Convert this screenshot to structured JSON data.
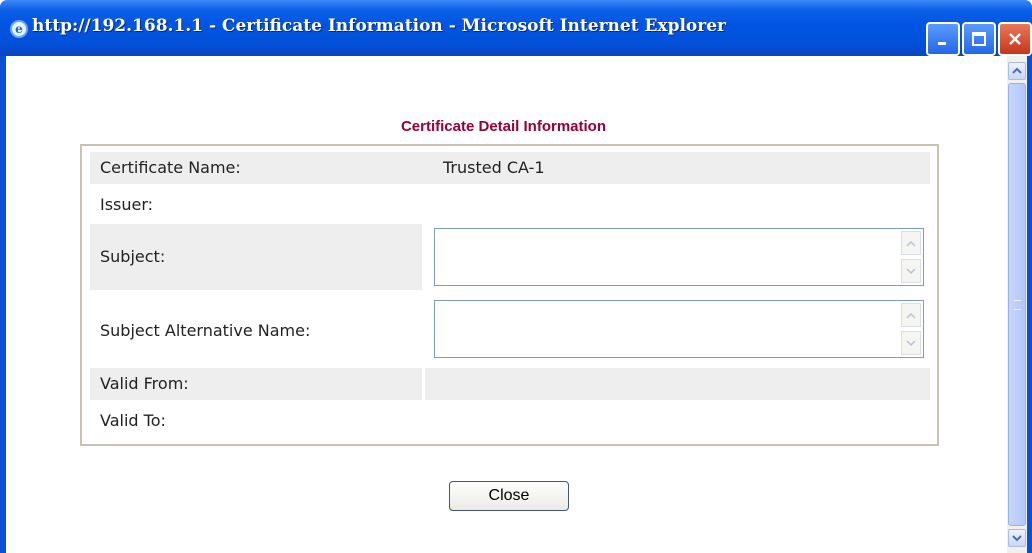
{
  "window": {
    "title": "http://192.168.1.1 - Certificate Information - Microsoft Internet Explorer",
    "buttons": {
      "minimize_icon": "minimize-icon",
      "maximize_icon": "maximize-icon",
      "close_icon": "close-icon"
    }
  },
  "page": {
    "heading": "Certificate Detail Information",
    "rows": [
      {
        "label": "Certificate Name:",
        "value": "Trusted CA-1"
      },
      {
        "label": "Issuer:",
        "value": ""
      },
      {
        "label": "Subject:",
        "value": ""
      },
      {
        "label": "Subject Alternative Name:",
        "value": ""
      },
      {
        "label": "Valid From:",
        "value": ""
      },
      {
        "label": "Valid To:",
        "value": ""
      }
    ],
    "close_label": "Close"
  },
  "colors": {
    "heading": "#990033",
    "row_shade": "#eeeeee",
    "titlebar": "#0054e3"
  }
}
